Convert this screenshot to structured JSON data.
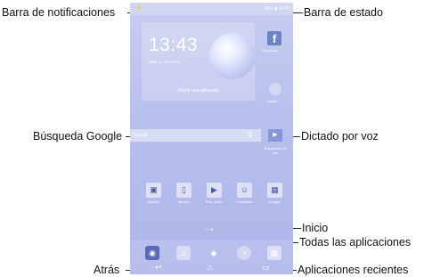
{
  "callouts": {
    "notification_bar": "Barra de notificaciones",
    "status_bar": "Barra de estado",
    "google_search": "Búsqueda Google",
    "voice_dictation": "Dictado por voz",
    "home": "Inicio",
    "all_apps": "Todas las aplicaciones",
    "back": "Atrás",
    "recent_apps": "Aplicaciones recientes"
  },
  "screen": {
    "status_left": "⚡ ↓",
    "status_right": "88% ▮ 13:43",
    "clock_time": "13:43",
    "clock_date": "MAR. 27 DE MAYO",
    "clock_location": "Añadir una ubicación",
    "facebook_label": "Facebook",
    "twitter_label": "Twitter",
    "search_placeholder": "Google",
    "voice_label": "Búsqueda por voz",
    "apps": [
      {
        "label": "Galería",
        "icon": "gallery-icon"
      },
      {
        "label": "Ajustes",
        "icon": "settings-icon"
      },
      {
        "label": "Play Store",
        "icon": "play-store-icon"
      },
      {
        "label": "Contactos",
        "icon": "contacts-icon"
      },
      {
        "label": "Google",
        "icon": "google-folder-icon"
      }
    ],
    "dock_icons": [
      "camera-icon",
      "music-icon",
      "apps-center-icon",
      "browser-icon",
      "all-apps-grid-icon"
    ]
  },
  "colors": {
    "wallpaper": "#b7bfed",
    "accent": "#8a95d8"
  }
}
